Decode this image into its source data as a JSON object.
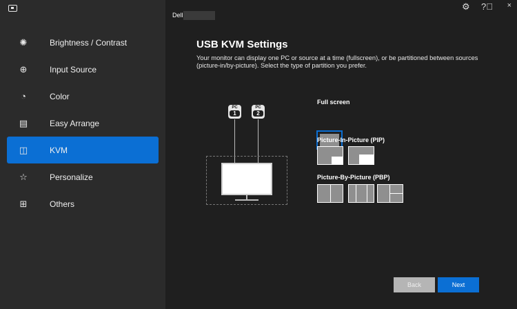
{
  "window": {
    "title": "Dell",
    "icons": [
      "monitor-app-icon",
      "gear-icon",
      "help-icon",
      "close-icon"
    ],
    "close_glyph": "×"
  },
  "sidebar": {
    "items": [
      {
        "label": "Brightness / Contrast",
        "icon": "brightness-icon",
        "active": false
      },
      {
        "label": "Input Source",
        "icon": "input-source-icon",
        "active": false
      },
      {
        "label": "Color",
        "icon": "color-palette-icon",
        "active": false
      },
      {
        "label": "Easy Arrange",
        "icon": "easy-arrange-icon",
        "active": false
      },
      {
        "label": "KVM",
        "icon": "kvm-icon",
        "active": true
      },
      {
        "label": "Personalize",
        "icon": "star-icon",
        "active": false
      },
      {
        "label": "Others",
        "icon": "others-icon",
        "active": false
      }
    ]
  },
  "main": {
    "title": "USB KVM Settings",
    "description": "Your monitor can display one PC or source at a time (fullscreen), or be partitioned between sources (picture-in/by-picture). Select the type of partition you prefer.",
    "pc_tags": [
      {
        "label": "PC",
        "number": "1"
      },
      {
        "label": "PC",
        "number": "2"
      }
    ],
    "sections": {
      "full_screen": "Full screen",
      "pip": "Picture-In-Picture (PIP)",
      "pbp": "Picture-By-Picture (PBP)"
    },
    "selected_layout": "Full screen"
  },
  "buttons": {
    "back": "Back",
    "next": "Next"
  },
  "colors": {
    "accent": "#0b6fd4",
    "sidebar_bg": "#2b2b2b",
    "main_bg": "#1f1f1f",
    "disabled_button": "#b5b5b5"
  }
}
